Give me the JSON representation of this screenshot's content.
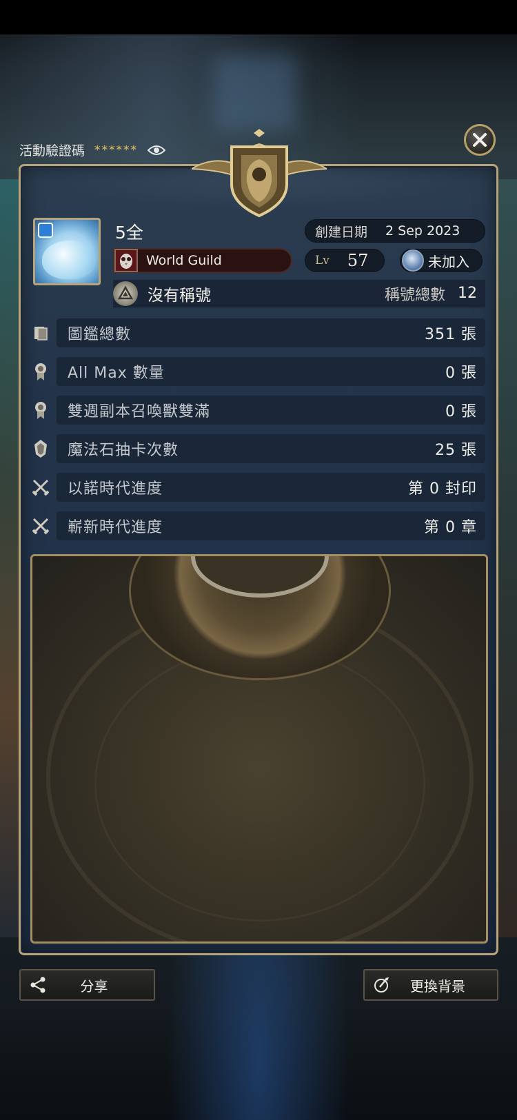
{
  "event_code": {
    "label": "活動驗證碼",
    "value": "******"
  },
  "profile": {
    "name": "5全",
    "created_label": "創建日期",
    "created_date": "2 Sep 2023",
    "guild_name": "World Guild",
    "level_label": "Lv",
    "level": "57",
    "join_status": "未加入",
    "title_name": "沒有稱號",
    "title_count_label": "稱號總數",
    "title_count": "12"
  },
  "stats": [
    {
      "icon": "card-stack-icon",
      "label": "圖鑑總數",
      "value": "351 張"
    },
    {
      "icon": "medal-icon",
      "label": "All Max 數量",
      "value": "0 張"
    },
    {
      "icon": "medal-icon",
      "label": "雙週副本召喚獸雙滿",
      "value": "0 張"
    },
    {
      "icon": "magic-stone-icon",
      "label": "魔法石抽卡次數",
      "value": "25 張"
    },
    {
      "icon": "crossed-swords-icon",
      "label": "以諾時代進度",
      "value": "第 0 封印"
    },
    {
      "icon": "crossed-swords-icon",
      "label": "嶄新時代進度",
      "value": "第 0 章"
    }
  ],
  "buttons": {
    "share": "分享",
    "change_background": "更換背景"
  },
  "colors": {
    "accent_gold": "#b7a47a",
    "panel_blue": "#23344a",
    "stars_yellow": "#e3c35b"
  }
}
